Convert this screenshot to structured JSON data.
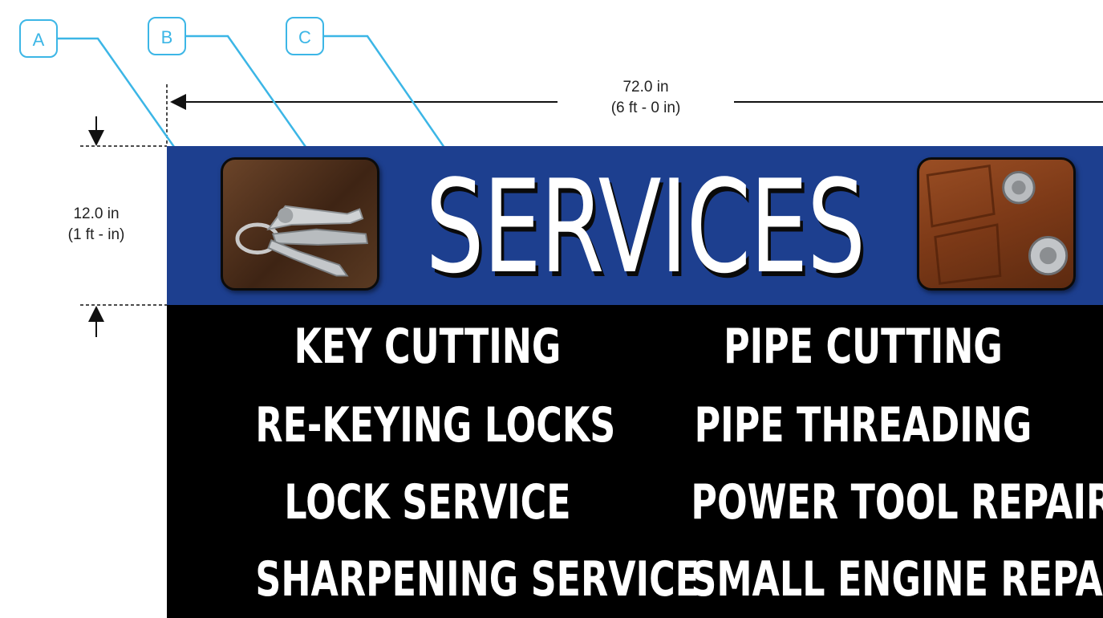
{
  "callouts": [
    "A",
    "B",
    "C"
  ],
  "dimensions": {
    "width_line1": "72.0 in",
    "width_line2": "(6 ft - 0 in)",
    "height_line1": "12.0 in",
    "height_line2": "(1 ft - in)"
  },
  "sign": {
    "title": "SERVICES",
    "banner_color": "#1d3f8f",
    "body_color": "#000000",
    "photos": [
      "keys-photo",
      "door-lock-photo"
    ],
    "services_left": [
      "KEY CUTTING",
      "RE-KEYING LOCKS",
      "LOCK SERVICE",
      "SHARPENING SERVICE"
    ],
    "services_right": [
      "PIPE CUTTING",
      "PIPE THREADING",
      "POWER TOOL REPAIR",
      "SMALL ENGINE REPAIR"
    ]
  },
  "colors": {
    "callout": "#3cb6e6",
    "dimension": "#222222"
  }
}
